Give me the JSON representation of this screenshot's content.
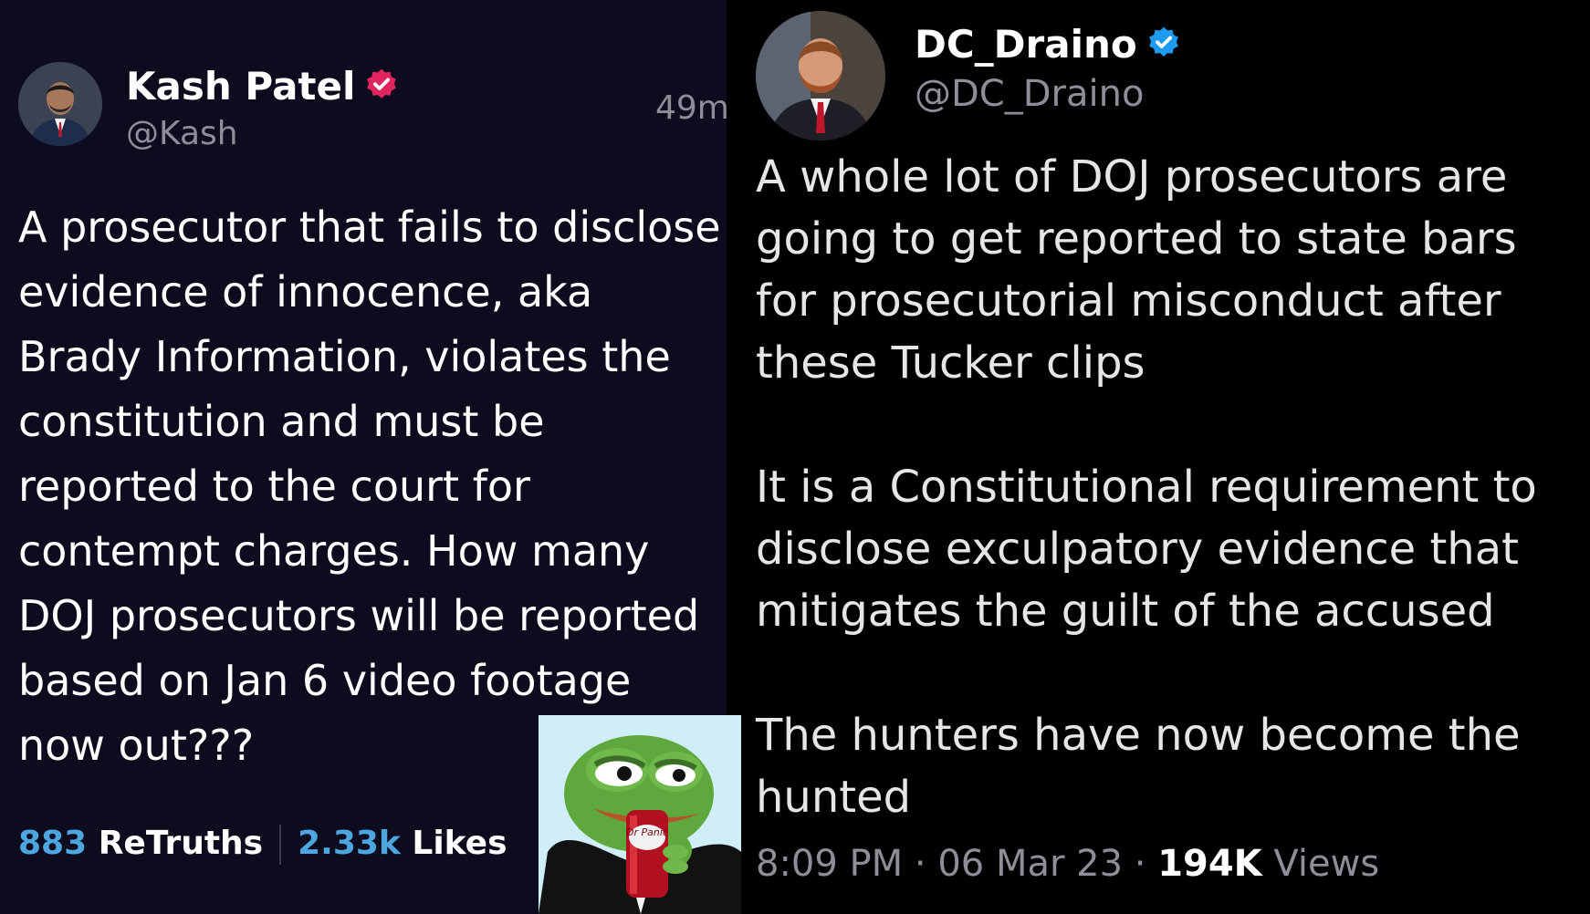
{
  "left_post": {
    "author_name": "Kash Patel",
    "handle": "@Kash",
    "time_ago": "49m",
    "body": "A prosecutor that fails to disclose evidence of innocence, aka Brady Information, violates the constitution and must be reported to the court for contempt charges. How many DOJ prosecutors will be reported based on Jan 6 video footage now out???",
    "retruths_count": "883",
    "retruths_label": "ReTruths",
    "likes_count": "2.33k",
    "likes_label": "Likes",
    "badge_color": "#e0245e",
    "accent_color": "#4ea6e0"
  },
  "meme": {
    "can_text": "Dr Panic",
    "icon": "pepe-frog-sipping-soda-icon"
  },
  "right_post": {
    "author_name": "DC_Draino",
    "handle": "@DC_Draino",
    "paragraphs": [
      "A whole lot of DOJ prosecutors are going to get reported to state bars for prosecutorial misconduct after these Tucker clips",
      "It is a Constitutional requirement to disclose exculpatory evidence that mitigates the guilt of the accused",
      "The hunters have now become the hunted"
    ],
    "time": "8:09 PM",
    "date": "06 Mar 23",
    "separator": "·",
    "views_count": "194K",
    "views_label": "Views",
    "badge_color": "#1d9bf0"
  }
}
